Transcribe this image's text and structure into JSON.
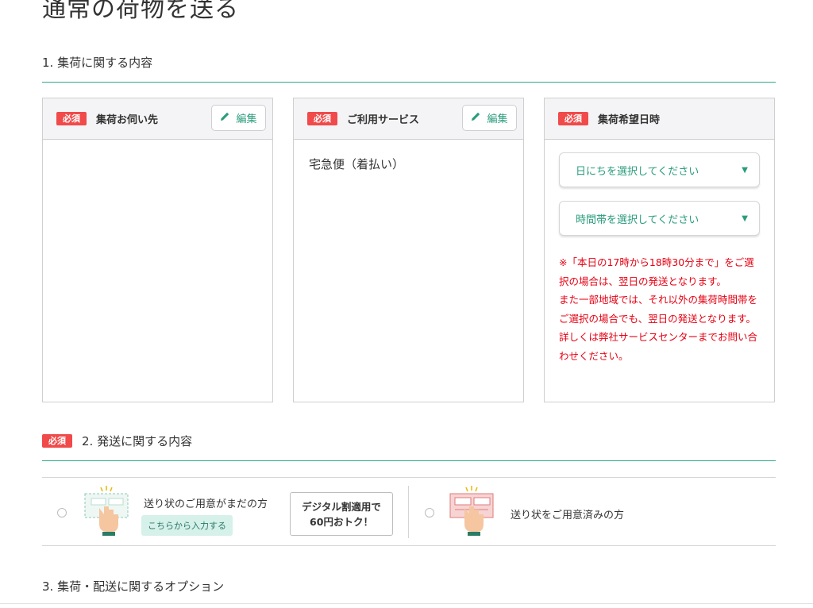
{
  "page": {
    "title": "通常の荷物を送る"
  },
  "section1": {
    "heading": "1. 集荷に関する内容"
  },
  "cards": {
    "required_label": "必須",
    "edit_label": "編集",
    "pickup_address": {
      "title": "集荷お伺い先"
    },
    "service": {
      "title": "ご利用サービス",
      "value": "宅急便（着払い）"
    },
    "pickup_datetime": {
      "title": "集荷希望日時",
      "date_select": "日にちを選択してください",
      "time_select": "時間帯を選択してください",
      "notice_line1": "※「本日の17時から18時30分まで」をご選択の場合は、翌日の発送となります。",
      "notice_line2": "また一部地域では、それ以外の集荷時間帯をご選択の場合でも、翌日の発送となります。",
      "notice_line3": "詳しくは弊社サービスセンターまでお問い合わせください。"
    }
  },
  "section2": {
    "required_label": "必須",
    "heading": "2. 発送に関する内容",
    "option_not_ready": {
      "label": "送り状のご用意がまだの方",
      "link": "こちらから入力する"
    },
    "promo_line1": "デジタル割適用で",
    "promo_line2": "60円おトク！",
    "option_ready": {
      "label": "送り状をご用意済みの方"
    }
  },
  "section3": {
    "heading": "3. 集荷・配送に関するオプション"
  },
  "colors": {
    "accent": "#2a9c7c",
    "required": "#f04a4a",
    "notice": "#e60012",
    "rule": "#2eaa8a"
  }
}
